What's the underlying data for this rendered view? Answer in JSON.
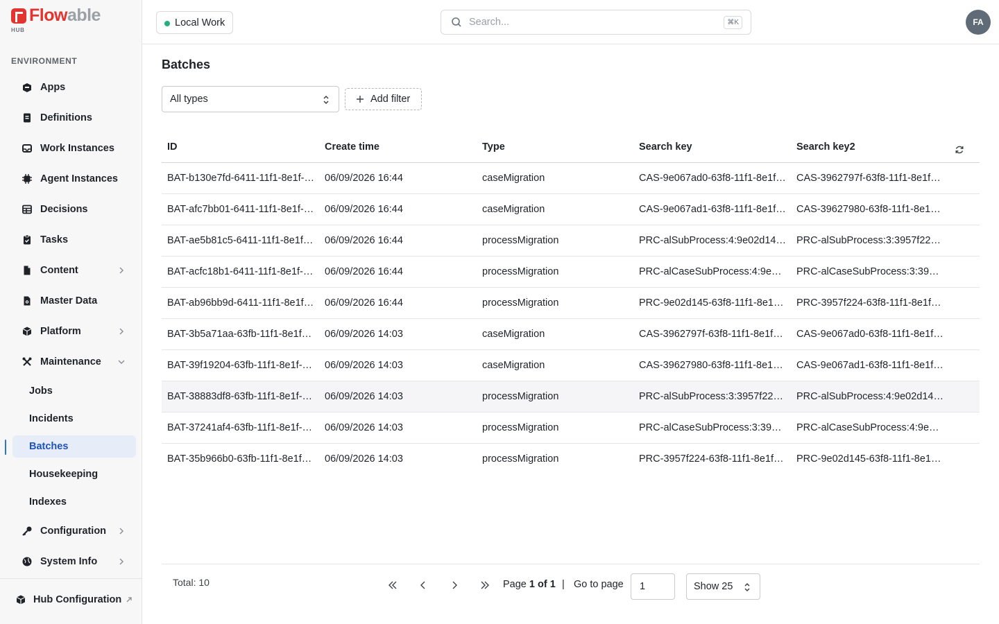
{
  "brand": {
    "name_part1": "Flow",
    "name_part2": "able",
    "sub": "HUB"
  },
  "sidebar": {
    "section_label": "ENVIRONMENT",
    "items": [
      {
        "label": "Apps",
        "icon": "apps-icon"
      },
      {
        "label": "Definitions",
        "icon": "definitions-icon"
      },
      {
        "label": "Work Instances",
        "icon": "inbox-icon"
      },
      {
        "label": "Agent Instances",
        "icon": "chip-icon"
      },
      {
        "label": "Decisions",
        "icon": "table-icon"
      },
      {
        "label": "Tasks",
        "icon": "clipboard-icon"
      },
      {
        "label": "Content",
        "icon": "document-icon"
      },
      {
        "label": "Master Data",
        "icon": "master-data-icon"
      },
      {
        "label": "Platform",
        "icon": "cube-icon"
      },
      {
        "label": "Maintenance",
        "icon": "tools-icon"
      }
    ],
    "maintenance_children": [
      "Jobs",
      "Incidents",
      "Batches",
      "Housekeeping",
      "Indexes"
    ],
    "bottom_items": [
      {
        "label": "Configuration",
        "icon": "key-icon"
      },
      {
        "label": "System Info",
        "icon": "globe-icon"
      }
    ],
    "footer": {
      "label": "Hub Configuration"
    }
  },
  "header": {
    "workspace": "Local Work",
    "search_placeholder": "Search...",
    "search_shortcut": "⌘K",
    "avatar_initials": "FA"
  },
  "main": {
    "title": "Batches",
    "type_filter": "All types",
    "add_filter": "Add filter",
    "columns": [
      "ID",
      "Create time",
      "Type",
      "Search key",
      "Search key2"
    ],
    "rows": [
      [
        "BAT-b130e7fd-6411-11f1-8e1f-d…",
        "06/09/2026 16:44",
        "caseMigration",
        "CAS-9e067ad0-63f8-11f1-8e1f…",
        "CAS-3962797f-63f8-11f1-8e1f…"
      ],
      [
        "BAT-afc7bb01-6411-11f1-8e1f-d…",
        "06/09/2026 16:44",
        "caseMigration",
        "CAS-9e067ad1-63f8-11f1-8e1f…",
        "CAS-39627980-63f8-11f1-8e1…"
      ],
      [
        "BAT-ae5b81c5-6411-11f1-8e1f-…",
        "06/09/2026 16:44",
        "processMigration",
        "PRC-alSubProcess:4:9e02d14…",
        "PRC-alSubProcess:3:3957f22…"
      ],
      [
        "BAT-acfc18b1-6411-11f1-8e1f-d…",
        "06/09/2026 16:44",
        "processMigration",
        "PRC-alCaseSubProcess:4:9e0…",
        "PRC-alCaseSubProcess:3:395…"
      ],
      [
        "BAT-ab96bb9d-6411-11f1-8e1f-…",
        "06/09/2026 16:44",
        "processMigration",
        "PRC-9e02d145-63f8-11f1-8e1f…",
        "PRC-3957f224-63f8-11f1-8e1f…"
      ],
      [
        "BAT-3b5a71aa-63fb-11f1-8e1f-…",
        "06/09/2026 14:03",
        "caseMigration",
        "CAS-3962797f-63f8-11f1-8e1f…",
        "CAS-9e067ad0-63f8-11f1-8e1f…"
      ],
      [
        "BAT-39f19204-63fb-11f1-8e1f-…",
        "06/09/2026 14:03",
        "caseMigration",
        "CAS-39627980-63f8-11f1-8e1…",
        "CAS-9e067ad1-63f8-11f1-8e1f…"
      ],
      [
        "BAT-38883df8-63fb-11f1-8e1f-…",
        "06/09/2026 14:03",
        "processMigration",
        "PRC-alSubProcess:3:3957f22…",
        "PRC-alSubProcess:4:9e02d14…"
      ],
      [
        "BAT-37241af4-63fb-11f1-8e1f-…",
        "06/09/2026 14:03",
        "processMigration",
        "PRC-alCaseSubProcess:3:395…",
        "PRC-alCaseSubProcess:4:9e0…"
      ],
      [
        "BAT-35b966b0-63fb-11f1-8e1f…",
        "06/09/2026 14:03",
        "processMigration",
        "PRC-3957f224-63f8-11f1-8e1f…",
        "PRC-9e02d145-63f8-11f1-8e1f…"
      ]
    ]
  },
  "pagination": {
    "total": "Total: 10",
    "page_prefix": "Page ",
    "page_of": "1 of 1",
    "separator": "|",
    "goto_label": "Go to page",
    "goto_value": "1",
    "page_size": "Show 25"
  },
  "colors": {
    "brand_red": "#e3342f",
    "active_blue": "#1e54b7",
    "active_bg": "#e6ecf8",
    "status_green": "#22b07d"
  }
}
